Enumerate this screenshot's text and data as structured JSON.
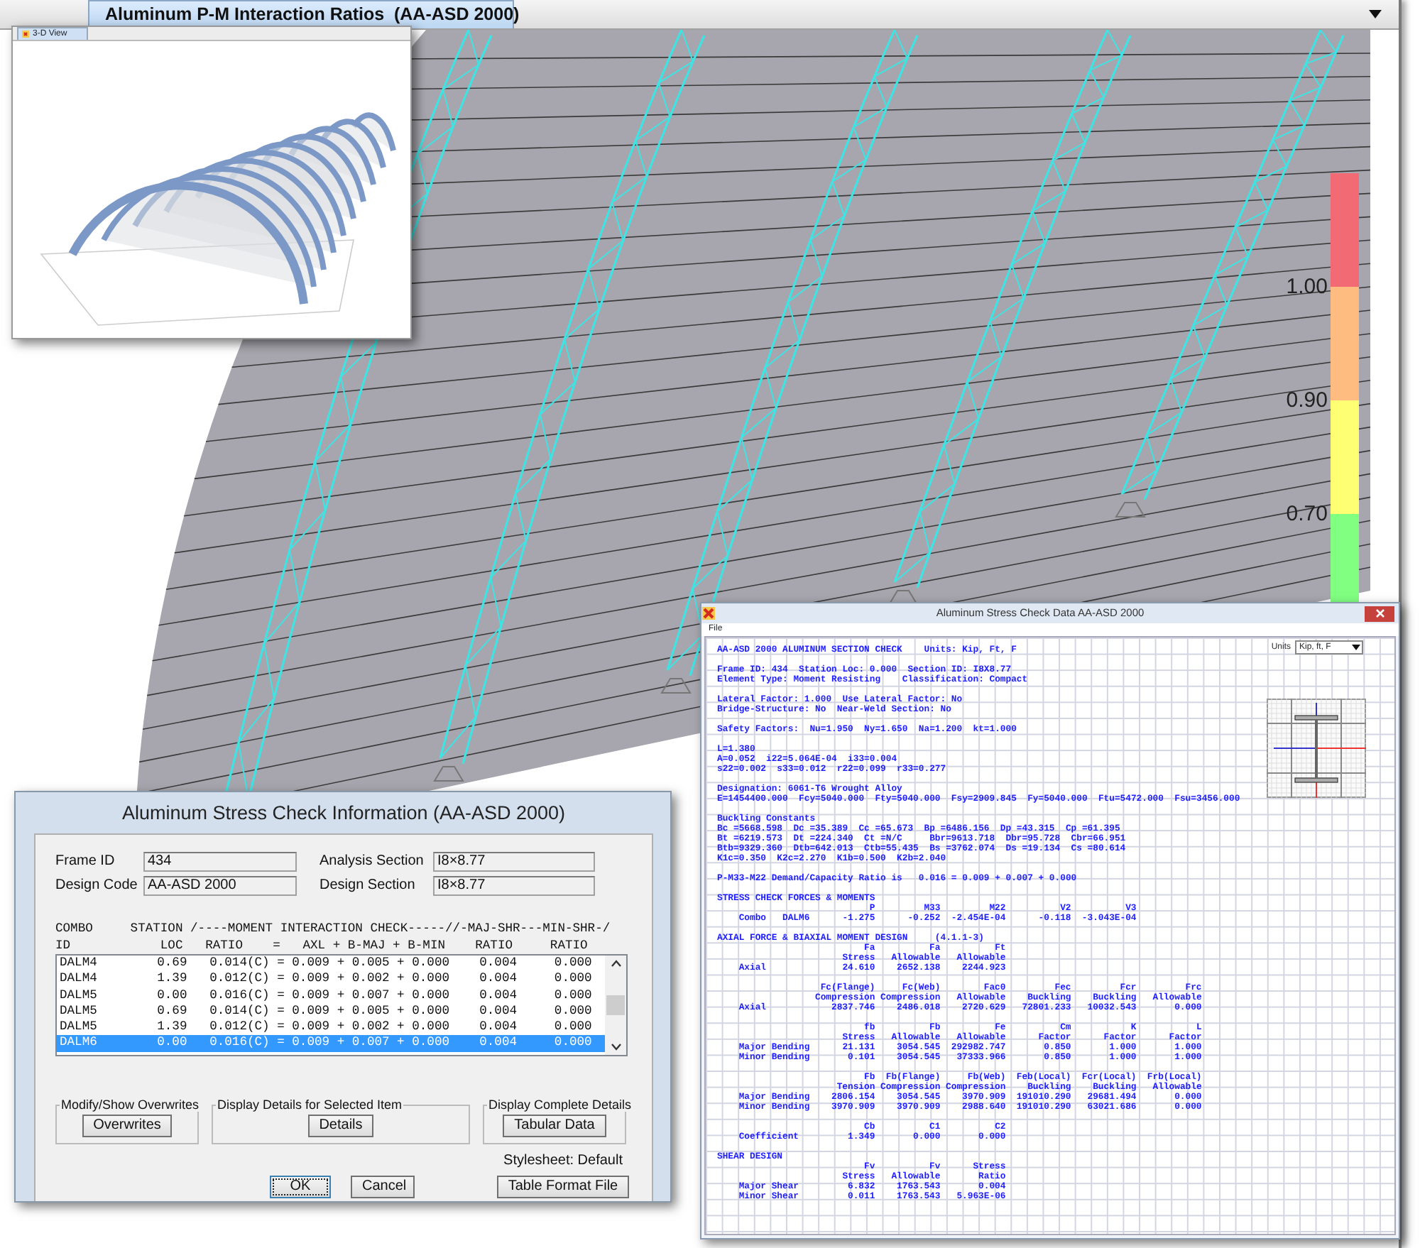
{
  "tab": {
    "title": "Aluminum P-M Interaction Ratios  (AA-ASD 2000)"
  },
  "legend": {
    "bands": [
      {
        "color": "#f26b74",
        "label": "1.00"
      },
      {
        "color": "#ffbc80",
        "label": "0.90"
      },
      {
        "color": "#ffff73",
        "label": "0.70"
      },
      {
        "color": "#80ff80"
      }
    ]
  },
  "inset_window": {
    "tab": "3-D View"
  },
  "check_dialog": {
    "title": "Aluminum Stress Check Information (AA-ASD 2000)",
    "fields": [
      {
        "label": "Frame ID",
        "value": "434"
      },
      {
        "label": "Design Code",
        "value": "AA-ASD 2000"
      },
      {
        "label": "Analysis Section",
        "value": "I8×8.77"
      },
      {
        "label": "Design Section",
        "value": "I8×8.77"
      }
    ],
    "header_lines": [
      "COMBO     STATION /----MOMENT INTERACTION CHECK-----//-MAJ-SHR---MIN-SHR-/",
      "ID            LOC   RATIO    =   AXL + B-MAJ + B-MIN    RATIO     RATIO"
    ],
    "rows": [
      {
        "text": "DALM4        0.69   0.014(C) = 0.009 + 0.005 + 0.000    0.004     0.000",
        "selected": false
      },
      {
        "text": "DALM4        1.39   0.012(C) = 0.009 + 0.002 + 0.000    0.004     0.000",
        "selected": false
      },
      {
        "text": "DALM5        0.00   0.016(C) = 0.009 + 0.007 + 0.000    0.004     0.000",
        "selected": false
      },
      {
        "text": "DALM5        0.69   0.014(C) = 0.009 + 0.005 + 0.000    0.004     0.000",
        "selected": false
      },
      {
        "text": "DALM5        1.39   0.012(C) = 0.009 + 0.002 + 0.000    0.004     0.000",
        "selected": false
      },
      {
        "text": "DALM6        0.00   0.016(C) = 0.009 + 0.007 + 0.000    0.004     0.000",
        "selected": true
      }
    ],
    "groups": [
      {
        "legend": "Modify/Show Overwrites",
        "button": "Overwrites"
      },
      {
        "legend": "Display Details for Selected Item",
        "button": "Details"
      },
      {
        "legend": "Display Complete Details",
        "button": "Tabular Data"
      }
    ],
    "stylesheet": "Stylesheet: Default",
    "buttons": [
      {
        "label": "OK",
        "default": true
      },
      {
        "label": "Cancel",
        "default": false
      },
      {
        "label": "Table Format File",
        "default": false
      }
    ]
  },
  "data_window": {
    "title": "Aluminum Stress Check Data  AA-ASD 2000",
    "menu": [
      "File"
    ],
    "units": {
      "label": "Units",
      "value": "Kip, ft, F"
    },
    "sections": [
      {
        "lines": [
          "AA-ASD 2000 ALUMINUM SECTION CHECK    Units: Kip, Ft, F"
        ]
      },
      {
        "lines": [
          "Frame ID: 434  Station Loc: 0.000  Section ID: I8X8.77",
          "Element Type: Moment Resisting    Classification: Compact"
        ]
      },
      {
        "lines": [
          "Lateral Factor: 1.000  Use Lateral Factor: No",
          "Bridge-Structure: No  Near-Weld Section: No"
        ]
      },
      {
        "lines": [
          "Safety Factors:  Nu=1.950  Ny=1.650  Na=1.200  kt=1.000"
        ]
      },
      {
        "lines": [
          "L=1.380",
          "A=0.052  i22=5.064E-04  i33=0.004",
          "s22=0.002  s33=0.012  r22=0.099  r33=0.277"
        ]
      },
      {
        "lines": [
          "Designation: 6061-T6 Wrought Alloy",
          "E=1454400.000  Fcy=5040.000  Fty=5040.000  Fsy=2909.845  Fy=5040.000  Ftu=5472.000  Fsu=3456.000"
        ]
      },
      {
        "lines": [
          "Buckling Constants",
          "Bc =5668.598  Dc =35.389  Cc =65.673  Bp =6486.156  Dp =43.315  Cp =61.395",
          "Bt =6219.573  Dt =224.340  Ct =N/C     Bbr=9613.718  Dbr=95.728  Cbr=66.951",
          "Btb=9329.360  Dtb=642.013  Ctb=55.435  Bs =3762.074  Ds =19.134  Cs =80.614",
          "K1c=0.350  K2c=2.270  K1b=0.500  K2b=2.040"
        ]
      },
      {
        "lines": [
          "P-M33-M22 Demand/Capacity Ratio is   0.016 = 0.009 + 0.007 + 0.000"
        ]
      },
      {
        "lines": [
          "STRESS CHECK FORCES & MOMENTS"
        ],
        "rows": [
          {
            "cells": [
              "P",
              "M33",
              "M22",
              "V2",
              "V3"
            ]
          },
          {
            "label": "Combo   DALM6",
            "cells": [
              "-1.275",
              "-0.252",
              "-2.454E-04",
              "-0.118",
              "-3.043E-04"
            ]
          }
        ]
      },
      {
        "lines": [
          "AXIAL FORCE & BIAXIAL MOMENT DESIGN     (4.1.1-3)"
        ],
        "rows": [
          {
            "cells": [
              "Fa",
              "Fa",
              "Ft"
            ]
          },
          {
            "cells": [
              "Stress",
              "Allowable",
              "Allowable"
            ]
          },
          {
            "label": "Axial",
            "cells": [
              "24.610",
              "2652.138",
              "2244.923"
            ]
          }
        ]
      },
      {
        "rows": [
          {
            "cells": [
              "Fc(Flange)",
              "Fc(Web)",
              "Fac0",
              "Fec",
              "Fcr",
              "Frc"
            ]
          },
          {
            "cells": [
              "Compression",
              "Compression",
              "Allowable",
              "Buckling",
              "Buckling",
              "Allowable"
            ]
          },
          {
            "label": "Axial",
            "cells": [
              "2837.746",
              "2486.018",
              "2720.629",
              "72801.233",
              "10032.543",
              "0.000"
            ]
          }
        ]
      },
      {
        "rows": [
          {
            "cells": [
              "fb",
              "Fb",
              "Fe",
              "Cm",
              "K",
              "L"
            ]
          },
          {
            "cells": [
              "Stress",
              "Allowable",
              "Allowable",
              "Factor",
              "Factor",
              "Factor"
            ]
          },
          {
            "label": "Major Bending",
            "cells": [
              "21.131",
              "3054.545",
              "292982.747",
              "0.850",
              "1.000",
              "1.000"
            ]
          },
          {
            "label": "Minor Bending",
            "cells": [
              "0.101",
              "3054.545",
              "37333.966",
              "0.850",
              "1.000",
              "1.000"
            ]
          }
        ]
      },
      {
        "rows": [
          {
            "cells": [
              "Fb",
              "Fb(Flange)",
              "Fb(Web)",
              "Feb(Local)",
              "Fcr(Local)",
              "Frb(Local)"
            ]
          },
          {
            "cells": [
              "Tension",
              "Compression",
              "Compression",
              "Buckling",
              "Buckling",
              "Allowable"
            ]
          },
          {
            "label": "Major Bending",
            "cells": [
              "2806.154",
              "3054.545",
              "3970.909",
              "191010.290",
              "29681.494",
              "0.000"
            ]
          },
          {
            "label": "Minor Bending",
            "cells": [
              "3970.909",
              "3970.909",
              "2988.640",
              "191010.290",
              "63021.686",
              "0.000"
            ]
          }
        ]
      },
      {
        "rows": [
          {
            "cells": [
              "Cb",
              "C1",
              "C2"
            ]
          },
          {
            "label": "Coefficient",
            "cells": [
              "1.349",
              "0.000",
              "0.000"
            ]
          }
        ]
      },
      {
        "lines": [
          "SHEAR DESIGN"
        ],
        "rows": [
          {
            "cells": [
              "Fv",
              "Fv",
              "Stress"
            ]
          },
          {
            "cells": [
              "Stress",
              "Allowable",
              "Ratio"
            ]
          },
          {
            "label": "Major Shear",
            "cells": [
              "6.832",
              "1763.543",
              "0.004"
            ]
          },
          {
            "label": "Minor Shear",
            "cells": [
              "0.011",
              "1763.543",
              "5.963E-06"
            ]
          }
        ]
      }
    ]
  }
}
